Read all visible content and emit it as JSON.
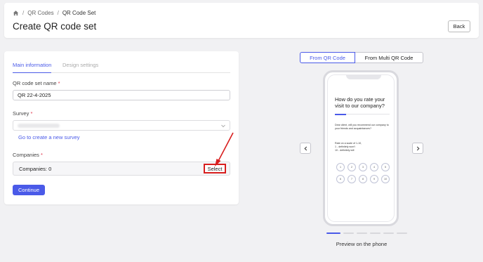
{
  "breadcrumb": {
    "items": [
      "QR Codes",
      "QR Code Set"
    ],
    "separator": "/"
  },
  "header": {
    "title": "Create QR code set",
    "back_label": "Back"
  },
  "form": {
    "tabs": [
      {
        "label": "Main information",
        "active": true
      },
      {
        "label": "Design settings",
        "active": false
      }
    ],
    "name_label": "QR code set name",
    "name_value": "QR 22-4-2025",
    "survey_label": "Survey",
    "survey_link": "Go to create a new survey",
    "companies_label": "Companies",
    "companies_value": "Companies: 0",
    "select_label": "Select",
    "required_mark": "*",
    "continue_label": "Continue"
  },
  "preview": {
    "toggle": [
      "From QR Code",
      "From Multi QR Code"
    ],
    "active_toggle": 0,
    "question_title": "How do you rate your visit to our company?",
    "question_desc": "Dear client, will you recommend our company to your friends and acquaintances?",
    "scale_text": "Rate on a scale of 1-10,",
    "scale_low": "1 - definitely won't",
    "scale_high": "10 - definitely will",
    "scale_values": [
      "1",
      "2",
      "3",
      "4",
      "5",
      "6",
      "7",
      "8",
      "9",
      "10"
    ],
    "label": "Preview on the phone",
    "pager_count": 6,
    "pager_active": 0
  },
  "colors": {
    "accent": "#4a5ae8",
    "highlight": "#d81e1e",
    "required": "#e0364b"
  },
  "icons": {
    "home": "home-icon",
    "chevron_left": "chevron-left-icon",
    "chevron_right": "chevron-right-icon",
    "dropdown": "chevron-down-icon",
    "annotation": "red-arrow-icon"
  }
}
